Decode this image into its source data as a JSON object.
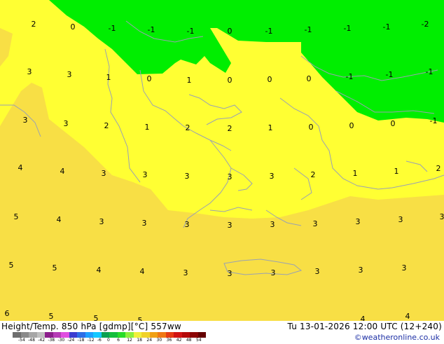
{
  "map": {
    "colors": {
      "warm_light": "#ffff33",
      "warm_dark": "#f8df45",
      "neutral_band": "#f2c94e",
      "cold": "#00ee00",
      "coastline": "#9aa2b2"
    },
    "values": [
      {
        "text": "2"
      },
      {
        "text": "0"
      },
      {
        "text": "-1"
      },
      {
        "text": "-1"
      },
      {
        "text": "-1"
      },
      {
        "text": "0"
      },
      {
        "text": "-1"
      },
      {
        "text": "-1"
      },
      {
        "text": "-1"
      },
      {
        "text": "-1"
      },
      {
        "text": "-2"
      },
      {
        "text": "3"
      },
      {
        "text": "3"
      },
      {
        "text": "1"
      },
      {
        "text": "0"
      },
      {
        "text": "1"
      },
      {
        "text": "0"
      },
      {
        "text": "0"
      },
      {
        "text": "0"
      },
      {
        "text": "-1"
      },
      {
        "text": "-1"
      },
      {
        "text": "-1"
      },
      {
        "text": "3"
      },
      {
        "text": "3"
      },
      {
        "text": "2"
      },
      {
        "text": "1"
      },
      {
        "text": "2"
      },
      {
        "text": "2"
      },
      {
        "text": "1"
      },
      {
        "text": "0"
      },
      {
        "text": "0"
      },
      {
        "text": "0"
      },
      {
        "text": "-1"
      },
      {
        "text": "4"
      },
      {
        "text": "4"
      },
      {
        "text": "3"
      },
      {
        "text": "3"
      },
      {
        "text": "3"
      },
      {
        "text": "3"
      },
      {
        "text": "3"
      },
      {
        "text": "2"
      },
      {
        "text": "1"
      },
      {
        "text": "1"
      },
      {
        "text": "2"
      },
      {
        "text": "5"
      },
      {
        "text": "4"
      },
      {
        "text": "3"
      },
      {
        "text": "3"
      },
      {
        "text": "3"
      },
      {
        "text": "3"
      },
      {
        "text": "3"
      },
      {
        "text": "3"
      },
      {
        "text": "3"
      },
      {
        "text": "3"
      },
      {
        "text": "3"
      },
      {
        "text": "5"
      },
      {
        "text": "5"
      },
      {
        "text": "4"
      },
      {
        "text": "4"
      },
      {
        "text": "3"
      },
      {
        "text": "3"
      },
      {
        "text": "3"
      },
      {
        "text": "3"
      },
      {
        "text": "3"
      },
      {
        "text": "3"
      },
      {
        "text": "6"
      },
      {
        "text": "5"
      },
      {
        "text": "5"
      },
      {
        "text": "5"
      },
      {
        "text": "4"
      },
      {
        "text": "4"
      }
    ]
  },
  "footer": {
    "title_left": "Height/Temp. 850 hPa [gdmp][°C] 557ww",
    "title_right": "Tu 13-01-2026 12:00 UTC (12+240)",
    "credit": "©weatheronline.co.uk",
    "colorbar": {
      "colors": [
        "#6e6e6e",
        "#8a8a8a",
        "#a6a6a6",
        "#c0c0c0",
        "#8c1f8c",
        "#b63cb6",
        "#e04de0",
        "#3c3cd0",
        "#2d6ee6",
        "#1ea0ff",
        "#14c8ff",
        "#0aa050",
        "#14be3c",
        "#28dc28",
        "#8cf03c",
        "#f0f03c",
        "#f0d228",
        "#f0a014",
        "#f07814",
        "#e63c14",
        "#d21414",
        "#b40a0a",
        "#8c0505",
        "#640000"
      ],
      "ticks": [
        "-54",
        "-48",
        "-42",
        "-38",
        "-30",
        "-24",
        "-18",
        "-12",
        "-6",
        "0",
        "6",
        "12",
        "18",
        "24",
        "30",
        "36",
        "42",
        "48",
        "54"
      ]
    }
  }
}
